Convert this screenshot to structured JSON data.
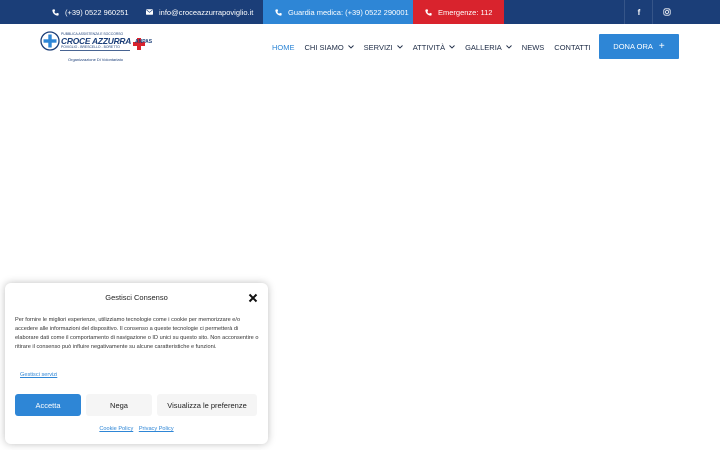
{
  "topbar": {
    "phone": "(+39) 0522 960251",
    "email": "info@croceazzurrapoviglio.it",
    "guardia": "Guardia medica: (+39) 0522 290001",
    "emergenze": "Emergenze: 112",
    "social": [
      "facebook-icon",
      "instagram-icon"
    ]
  },
  "logo": {
    "line1": "PUBBLICA ASSISTENZA E SOCCORSO",
    "name": "CROCE AZZURRA",
    "towns": "POVIGLIO - BRESCELLO - BORETTO",
    "badge": "ANPAS",
    "subtitle": "Organizzazione Di Volontariato"
  },
  "nav": {
    "home": "HOME",
    "chi_siamo": "CHI SIAMO",
    "servizi": "SERVIZI",
    "attivita": "ATTIVITÀ",
    "galleria": "GALLERIA",
    "news": "NEWS",
    "contatti": "CONTATTI"
  },
  "cta": {
    "dona": "DONA ORA"
  },
  "consent": {
    "title": "Gestisci Consenso",
    "text": "Per fornire le migliori esperienze, utilizziamo tecnologie come i cookie per memorizzare e/o accedere alle informazioni del dispositivo. Il consenso a queste tecnologie ci permetterà di elaborare dati come il comportamento di navigazione o ID unici su questo sito. Non acconsentire o ritirare il consenso può influire negativamente su alcune caratteristiche e funzioni.",
    "manage_link": "Gestisci servizi",
    "accept": "Accetta",
    "deny": "Nega",
    "prefs": "Visualizza le preferenze",
    "cookie_policy": "Cookie Policy",
    "privacy_policy": "Privacy Policy"
  },
  "colors": {
    "dark_blue": "#1b3e78",
    "accent_blue": "#2e86d6",
    "red": "#d9232d"
  }
}
